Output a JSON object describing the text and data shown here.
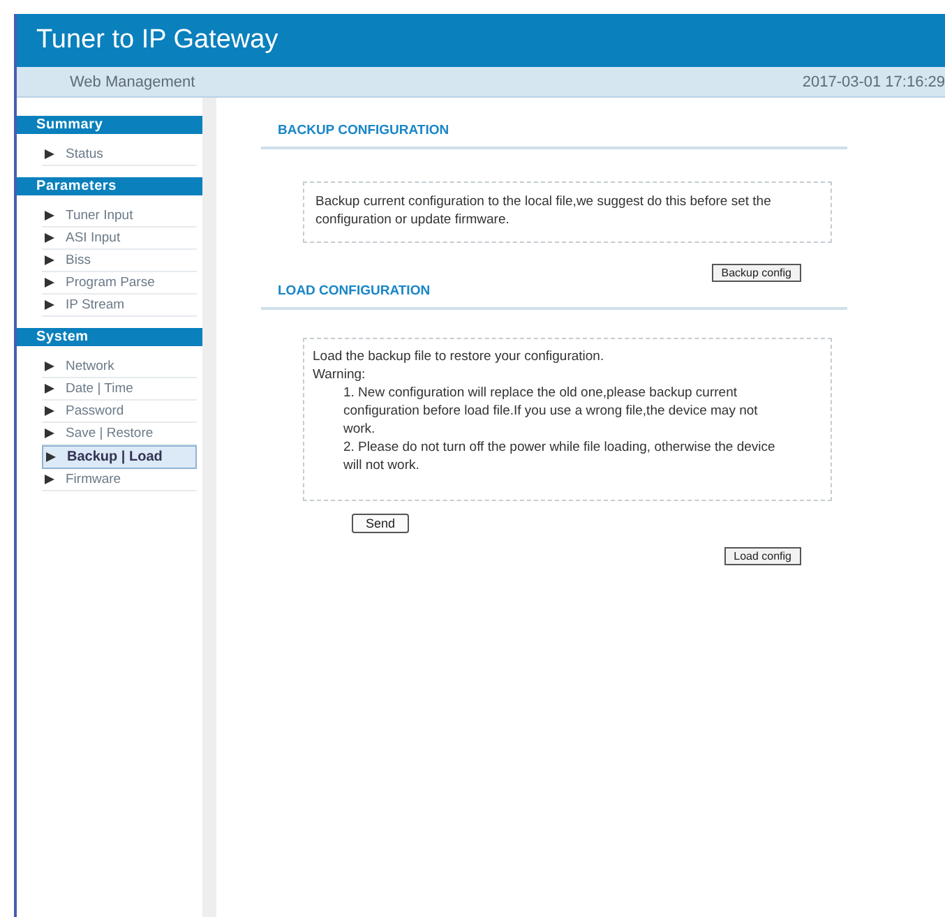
{
  "header": {
    "title": "Tuner to IP Gateway",
    "subtitle": "Web Management",
    "datetime": "2017-03-01 17:16:29"
  },
  "sidebar": [
    {
      "title": "Summary",
      "items": [
        {
          "label": "Status",
          "selected": false
        }
      ]
    },
    {
      "title": "Parameters",
      "items": [
        {
          "label": "Tuner Input",
          "selected": false
        },
        {
          "label": "ASI Input",
          "selected": false
        },
        {
          "label": "Biss",
          "selected": false
        },
        {
          "label": "Program Parse",
          "selected": false
        },
        {
          "label": "IP Stream",
          "selected": false
        }
      ]
    },
    {
      "title": "System",
      "items": [
        {
          "label": "Network",
          "selected": false
        },
        {
          "label": "Date | Time",
          "selected": false
        },
        {
          "label": "Password",
          "selected": false
        },
        {
          "label": "Save | Restore",
          "selected": false
        },
        {
          "label": "Backup | Load",
          "selected": true
        },
        {
          "label": "Firmware",
          "selected": false
        }
      ]
    }
  ],
  "backup": {
    "heading": "BACKUP CONFIGURATION",
    "text": "Backup current configuration to the local file,we suggest do this before set the configuration or update firmware.",
    "button": "Backup config"
  },
  "load": {
    "heading": "LOAD CONFIGURATION",
    "intro": "Load the backup file to restore your configuration.",
    "warning_label": "Warning:",
    "warnings": [
      "1. New configuration will replace the old one,please backup current configuration before load file.If you use a wrong file,the device may not work.",
      "2. Please do not turn off the power while file loading, otherwise the device will not work."
    ],
    "send_button": "Send",
    "button": "Load config"
  }
}
